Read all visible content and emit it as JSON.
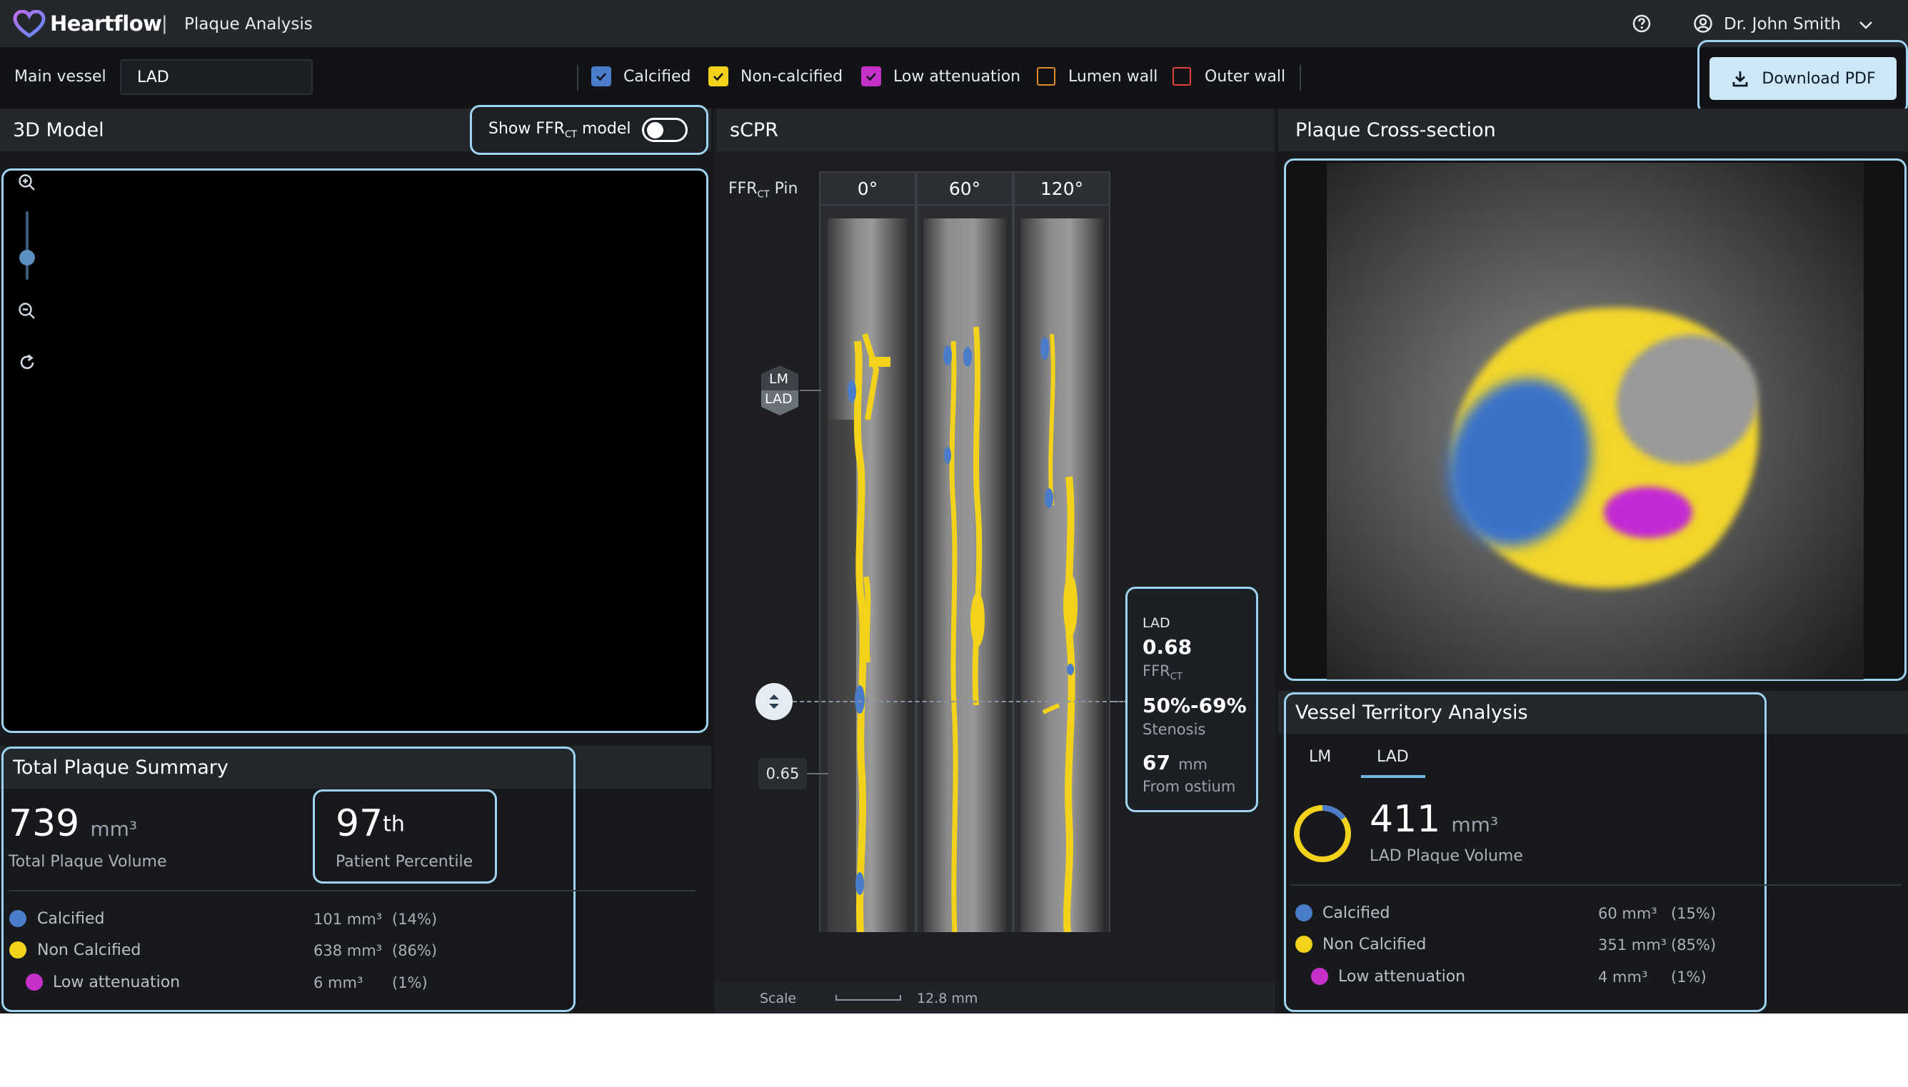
{
  "header": {
    "brand": "Heartflow",
    "separator": "|",
    "page_title": "Plaque Analysis",
    "user_name": "Dr. John Smith"
  },
  "filters": {
    "main_vessel_label": "Main vessel",
    "main_vessel_value": "LAD",
    "items": [
      {
        "label": "Calcified",
        "checked": true,
        "color": "#4a7cc9"
      },
      {
        "label": "Non-calcified",
        "checked": true,
        "color": "#f3d21b"
      },
      {
        "label": "Low attenuation",
        "checked": true,
        "color": "#c531c9"
      },
      {
        "label": "Lumen wall",
        "checked": false,
        "color": "#e08a2a"
      },
      {
        "label": "Outer wall",
        "checked": false,
        "color": "#e2403e"
      }
    ],
    "download_label": "Download PDF"
  },
  "model3d": {
    "title": "3D Model",
    "toggle_label_pre": "Show FFR",
    "toggle_label_sub": "CT",
    "toggle_label_post": " model",
    "toggle_on": false
  },
  "scpr": {
    "title": "sCPR",
    "pin_label": "FFR",
    "pin_label_sub": "CT",
    "pin_label_post": " Pin",
    "angles": [
      "0°",
      "60°",
      "120°"
    ],
    "marker_top": "LM",
    "marker_bottom": "LAD",
    "value_chip": "0.65",
    "info": {
      "vessel": "LAD",
      "ffr_value": "0.68",
      "ffr_label": "FFR",
      "ffr_label_sub": "CT",
      "stenosis_value": "50%-69%",
      "stenosis_label": "Stenosis",
      "distance_value": "67",
      "distance_unit": "mm",
      "distance_label": "From ostium"
    },
    "scale_label": "Scale",
    "scale_value": "12.8 mm"
  },
  "cross_section": {
    "title": "Plaque Cross-section"
  },
  "total_summary": {
    "title": "Total Plaque Summary",
    "volume_value": "739",
    "volume_unit": "mm³",
    "volume_label": "Total Plaque Volume",
    "percentile_value": "97",
    "percentile_suffix": "th",
    "percentile_label": "Patient Percentile",
    "rows": [
      {
        "label": "Calcified",
        "value": "101 mm³",
        "pct": "(14%)",
        "color": "#4a7cc9"
      },
      {
        "label": "Non Calcified",
        "value": "638 mm³",
        "pct": "(86%)",
        "color": "#f3d21b"
      },
      {
        "label": "Low attenuation",
        "value": "6 mm³",
        "pct": "(1%)",
        "color": "#c531c9"
      }
    ]
  },
  "territory": {
    "title": "Vessel Territory Analysis",
    "tabs": [
      "LM",
      "LAD"
    ],
    "active_tab": 1,
    "volume_value": "411",
    "volume_unit": "mm³",
    "volume_label": "LAD Plaque Volume",
    "donut_calcified_fraction": 0.15,
    "rows": [
      {
        "label": "Calcified",
        "value": "60 mm³",
        "pct": "(15%)",
        "color": "#4a7cc9"
      },
      {
        "label": "Non Calcified",
        "value": "351 mm³",
        "pct": "(85%)",
        "color": "#f3d21b"
      },
      {
        "label": "Low attenuation",
        "value": "4 mm³",
        "pct": "(1%)",
        "color": "#c531c9"
      }
    ]
  }
}
